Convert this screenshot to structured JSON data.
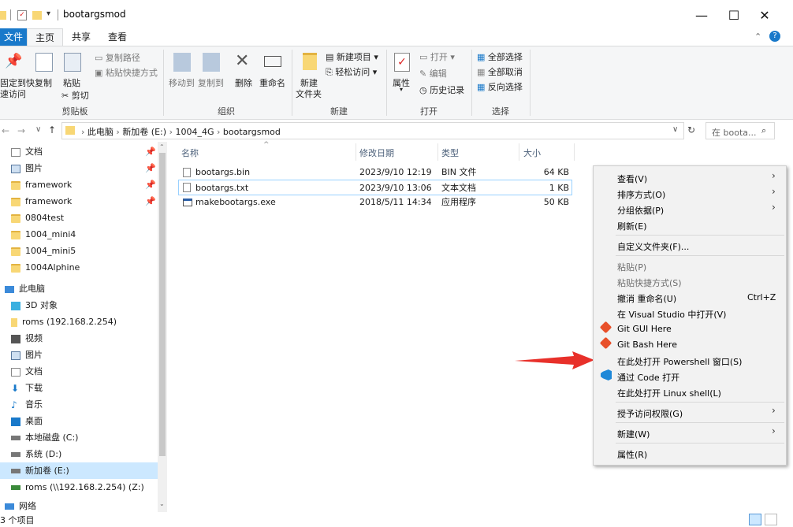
{
  "window": {
    "title": "bootargsmod"
  },
  "tabs": [
    "文件",
    "主页",
    "共享",
    "查看"
  ],
  "ribbon": {
    "clipboard": {
      "pin1": "固定到快",
      "pin2": "速访问",
      "copy": "复制",
      "paste": "粘贴",
      "copy_path": "复制路径",
      "paste_shortcut": "粘贴快捷方式",
      "cut": "剪切",
      "label": "剪贴板"
    },
    "organize": {
      "move_to": "移动到",
      "copy_to": "复制到",
      "delete": "删除",
      "rename": "重命名",
      "label": "组织"
    },
    "new": {
      "new_folder1": "新建",
      "new_folder2": "文件夹",
      "new_item": "新建项目",
      "easy_access": "轻松访问",
      "label": "新建"
    },
    "open": {
      "properties": "属性",
      "open": "打开",
      "edit": "编辑",
      "history": "历史记录",
      "label": "打开"
    },
    "select": {
      "select_all": "全部选择",
      "select_none": "全部取消",
      "invert": "反向选择",
      "label": "选择"
    }
  },
  "address": {
    "parts": [
      "此电脑",
      "新加卷 (E:)",
      "1004_4G",
      "bootargsmod"
    ],
    "search_placeholder": "在 boota..."
  },
  "nav": {
    "quick": [
      "文档",
      "图片",
      "framework",
      "framework",
      "0804test",
      "1004_mini4",
      "1004_mini5",
      "1004Alphine"
    ],
    "pc_label": "此电脑",
    "pc": [
      "3D 对象",
      "roms (192.168.2.254)",
      "视频",
      "图片",
      "文档",
      "下载",
      "音乐",
      "桌面",
      "本地磁盘 (C:)",
      "系统 (D:)",
      "新加卷 (E:)",
      "roms (\\\\192.168.2.254) (Z:)"
    ],
    "network": "网络"
  },
  "columns": {
    "name": "名称",
    "date": "修改日期",
    "type": "类型",
    "size": "大小"
  },
  "files": [
    {
      "name": "bootargs.bin",
      "date": "2023/9/10 12:19",
      "type": "BIN 文件",
      "size": "64 KB"
    },
    {
      "name": "bootargs.txt",
      "date": "2023/9/10 13:06",
      "type": "文本文档",
      "size": "1 KB"
    },
    {
      "name": "makebootargs.exe",
      "date": "2018/5/11 14:34",
      "type": "应用程序",
      "size": "50 KB"
    }
  ],
  "context_menu": {
    "view": "查看(V)",
    "sort": "排序方式(O)",
    "group": "分组依据(P)",
    "refresh": "刷新(E)",
    "customize": "自定义文件夹(F)...",
    "paste": "粘贴(P)",
    "paste_shortcut": "粘贴快捷方式(S)",
    "undo": "撤消 重命名(U)",
    "undo_shortcut": "Ctrl+Z",
    "vs": "在 Visual Studio 中打开(V)",
    "git_gui": "Git GUI Here",
    "git_bash": "Git Bash Here",
    "powershell": "在此处打开 Powershell 窗口(S)",
    "code": "通过 Code 打开",
    "linux": "在此处打开 Linux shell(L)",
    "access": "授予访问权限(G)",
    "new": "新建(W)",
    "properties": "属性(R)"
  },
  "status": {
    "count": "3 个项目"
  },
  "colors": {
    "accent": "#1979ca",
    "arrow": "#e8302a",
    "selection": "#cce8ff"
  }
}
